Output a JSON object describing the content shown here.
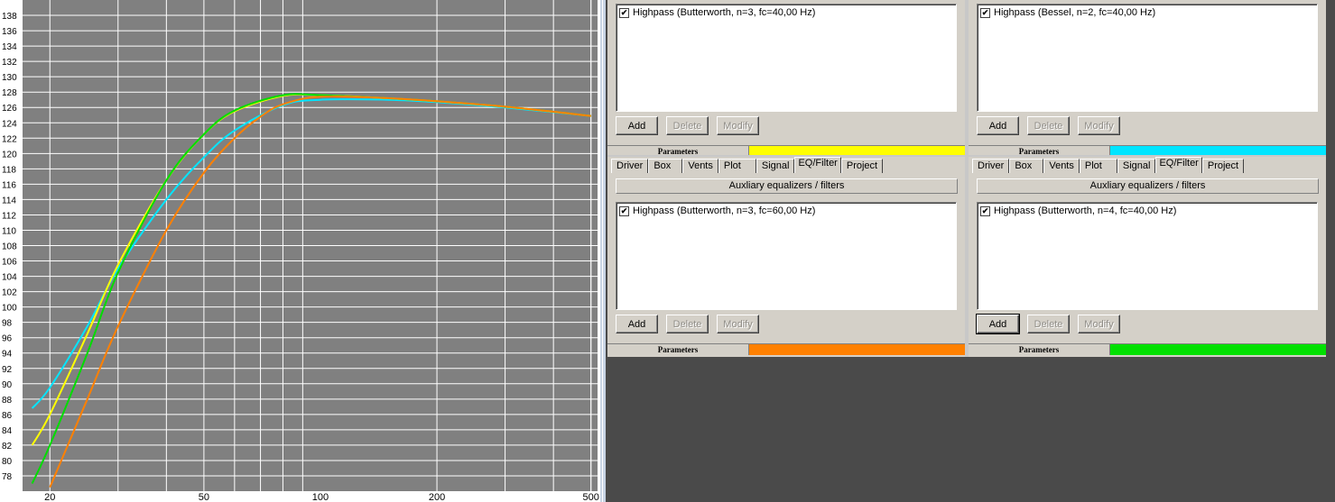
{
  "chart_data": {
    "type": "line",
    "xscale": "log",
    "xlim": [
      17,
      520
    ],
    "ylim": [
      76,
      140
    ],
    "x_ticks": [
      "20",
      "50",
      "100",
      "200",
      "500"
    ],
    "y_ticks": [
      "78",
      "80",
      "82",
      "84",
      "86",
      "88",
      "90",
      "92",
      "94",
      "96",
      "98",
      "100",
      "102",
      "104",
      "106",
      "108",
      "110",
      "112",
      "114",
      "116",
      "118",
      "120",
      "122",
      "124",
      "126",
      "128",
      "130",
      "132",
      "134",
      "136",
      "138"
    ],
    "grid": true,
    "series": [
      {
        "color": "#00e5ff",
        "x": [
          18,
          20,
          25,
          30,
          40,
          50,
          60,
          80,
          100,
          150,
          200,
          300,
          500
        ],
        "y": [
          86.8,
          89.5,
          97.5,
          105.0,
          114.0,
          119.5,
          123.0,
          126.3,
          127.0,
          127.0,
          126.7,
          126.0,
          124.9
        ]
      },
      {
        "color": "#ffff00",
        "x": [
          18,
          20,
          25,
          30,
          40,
          50,
          60,
          80,
          100,
          150,
          200,
          300,
          500
        ],
        "y": [
          82.0,
          86.0,
          96.5,
          105.5,
          116.5,
          122.5,
          125.5,
          127.5,
          127.6,
          127.2,
          126.8,
          126.1,
          124.9
        ]
      },
      {
        "color": "#00dd00",
        "x": [
          18,
          20,
          25,
          30,
          40,
          50,
          60,
          80,
          100,
          150,
          200,
          300,
          500
        ],
        "y": [
          77.0,
          82.0,
          94.0,
          104.5,
          116.5,
          122.5,
          125.6,
          127.6,
          127.6,
          127.2,
          126.8,
          126.1,
          124.9
        ]
      },
      {
        "color": "#ff8000",
        "x": [
          20,
          25,
          30,
          40,
          50,
          60,
          70,
          80,
          100,
          150,
          200,
          300,
          500
        ],
        "y": [
          76.5,
          88.0,
          97.5,
          110.0,
          117.5,
          122.0,
          124.8,
          126.4,
          127.4,
          127.2,
          126.8,
          126.1,
          124.9
        ]
      }
    ]
  },
  "panels": {
    "top_left": {
      "filter_item": "Highpass (Butterworth, n=3, fc=40,00 Hz)",
      "checked": "✔",
      "buttons": {
        "add": "Add",
        "delete": "Delete",
        "modify": "Modify"
      },
      "params_label": "Parameters",
      "color": "#ffff00"
    },
    "top_right": {
      "filter_item": "Highpass (Bessel, n=2, fc=40,00 Hz)",
      "checked": "✔",
      "buttons": {
        "add": "Add",
        "delete": "Delete",
        "modify": "Modify"
      },
      "params_label": "Parameters",
      "color": "#00e5ff"
    },
    "bottom_left": {
      "tabs": [
        "Driver",
        "Box",
        "Vents",
        "Plot",
        "Signal",
        "EQ/Filter",
        "Project"
      ],
      "active_tab": "EQ/Filter",
      "header": "Auxliary equalizers / filters",
      "filter_item": "Highpass (Butterworth, n=3, fc=60,00 Hz)",
      "checked": "✔",
      "buttons": {
        "add": "Add",
        "delete": "Delete",
        "modify": "Modify"
      },
      "params_label": "Parameters",
      "color": "#ff8000"
    },
    "bottom_right": {
      "tabs": [
        "Driver",
        "Box",
        "Vents",
        "Plot",
        "Signal",
        "EQ/Filter",
        "Project"
      ],
      "active_tab": "EQ/Filter",
      "header": "Auxliary equalizers / filters",
      "filter_item": "Highpass (Butterworth, n=4, fc=40,00 Hz)",
      "checked": "✔",
      "buttons": {
        "add": "Add",
        "delete": "Delete",
        "modify": "Modify"
      },
      "params_label": "Parameters",
      "color": "#00e000"
    }
  }
}
